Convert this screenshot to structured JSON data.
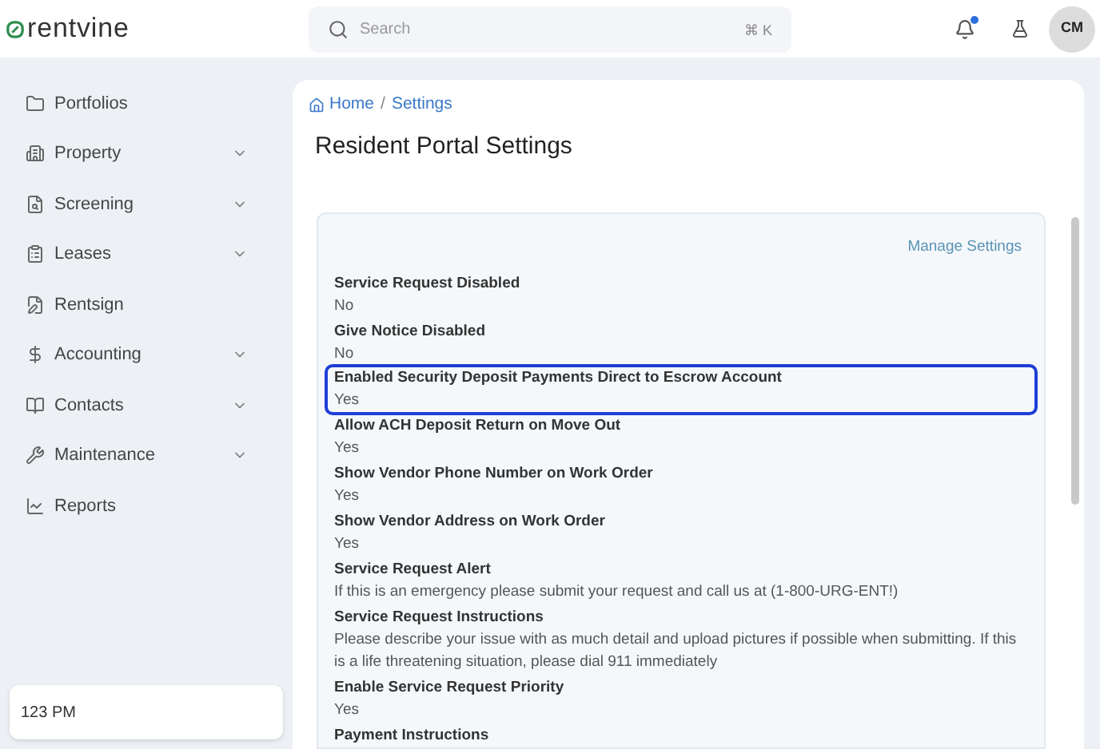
{
  "brand": {
    "name": "rentvine"
  },
  "search": {
    "placeholder": "Search",
    "shortcut": "⌘ K"
  },
  "header": {
    "notification_dot": true,
    "avatar": "CM"
  },
  "sidebar": {
    "items": [
      {
        "label": "Portfolios",
        "expandable": false
      },
      {
        "label": "Property",
        "expandable": true
      },
      {
        "label": "Screening",
        "expandable": true
      },
      {
        "label": "Leases",
        "expandable": true
      },
      {
        "label": "Rentsign",
        "expandable": false
      },
      {
        "label": "Accounting",
        "expandable": true
      },
      {
        "label": "Contacts",
        "expandable": true
      },
      {
        "label": "Maintenance",
        "expandable": true
      },
      {
        "label": "Reports",
        "expandable": false
      }
    ],
    "footer": "123 PM"
  },
  "breadcrumb": {
    "items": [
      "Home",
      "Settings"
    ],
    "separator": "/"
  },
  "page_title": "Resident Portal Settings",
  "manage_link": "Manage Settings",
  "settings": [
    {
      "label": "Service Request Disabled",
      "value": "No",
      "highlighted": false
    },
    {
      "label": "Give Notice Disabled",
      "value": "No",
      "highlighted": false
    },
    {
      "label": "Enabled Security Deposit Payments Direct to Escrow Account",
      "value": "Yes",
      "highlighted": true
    },
    {
      "label": "Allow ACH Deposit Return on Move Out",
      "value": "Yes",
      "highlighted": false
    },
    {
      "label": "Show Vendor Phone Number on Work Order",
      "value": "Yes",
      "highlighted": false
    },
    {
      "label": "Show Vendor Address on Work Order",
      "value": "Yes",
      "highlighted": false
    },
    {
      "label": "Service Request Alert",
      "value": "If this is an emergency please submit your request and call us at (1-800-URG-ENT!)",
      "highlighted": false
    },
    {
      "label": "Service Request Instructions",
      "value": "Please describe your issue with as much detail and upload pictures if possible when submitting. If this is a life threatening situation, please dial 911 immediately",
      "highlighted": false
    },
    {
      "label": "Enable Service Request Priority",
      "value": "Yes",
      "highlighted": false
    },
    {
      "label": "Payment Instructions",
      "highlighted": false
    }
  ]
}
